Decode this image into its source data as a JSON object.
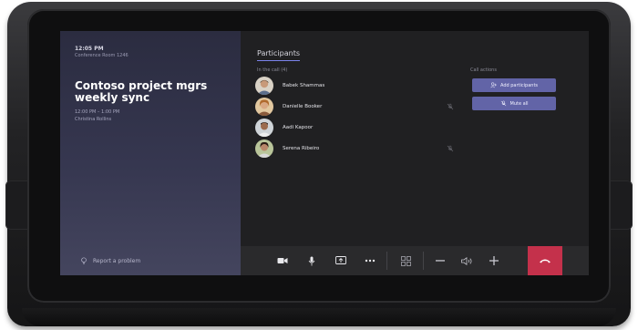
{
  "left_panel": {
    "clock": "12:05 PM",
    "room": "Conference Room 1246",
    "meeting_title": "Contoso project mgrs weekly sync",
    "meeting_time": "12:00 PM – 1:00 PM",
    "organizer": "Christina Rollins",
    "report_problem": "Report a problem"
  },
  "participants": {
    "title": "Participants",
    "section_label": "In the call (4)",
    "list": [
      {
        "name": "Babek Shammas",
        "muted": false
      },
      {
        "name": "Danielle Booker",
        "muted": true
      },
      {
        "name": "Aadi Kapoor",
        "muted": false
      },
      {
        "name": "Serena Ribeiro",
        "muted": true
      }
    ]
  },
  "call_actions": {
    "label": "Call actions",
    "add_participants": "Add participants",
    "mute_all": "Mute all"
  },
  "call_bar": {
    "icons": [
      "video-camera-icon",
      "microphone-icon",
      "share-screen-icon",
      "more-options-icon",
      "layout-grid-icon",
      "volume-down-icon",
      "speaker-icon",
      "volume-up-icon",
      "hang-up-icon"
    ]
  },
  "colors": {
    "accent": "#6264a7",
    "hangup": "#c4314b",
    "left_panel": "#363750",
    "screen_bg": "#202022"
  }
}
